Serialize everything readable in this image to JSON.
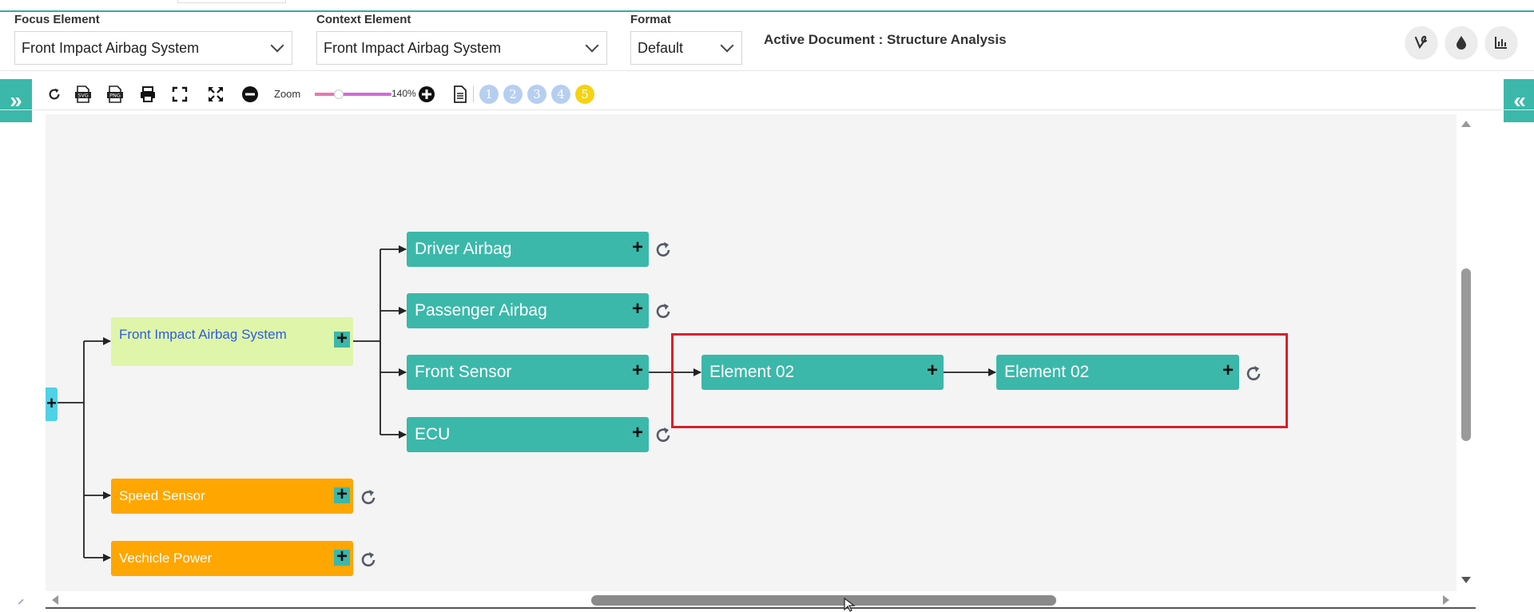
{
  "filters": {
    "focus": {
      "label": "Focus Element",
      "value": "Front Impact Airbag System"
    },
    "context": {
      "label": "Context Element",
      "value": "Front Impact Airbag System"
    },
    "format": {
      "label": "Format",
      "value": "Default"
    },
    "active_document": "Active Document : Structure Analysis"
  },
  "header_buttons": [
    "vine-icon",
    "drop-icon",
    "bar-chart-icon"
  ],
  "toolbar": {
    "icons": [
      "refresh-icon",
      "svg-export-icon",
      "png-export-icon",
      "print-icon",
      "fit-screen-icon",
      "expand-icon",
      "zoom-out-icon"
    ],
    "zoom_label": "Zoom",
    "zoom_value": "140%",
    "zoom_fraction": 0.27,
    "levels": [
      "1",
      "2",
      "3",
      "4",
      "5"
    ],
    "active_level": "5"
  },
  "tree": {
    "root": "Front Impact Airbag System",
    "children": [
      "Driver Airbag",
      "Passenger Airbag",
      "Front Sensor",
      "ECU"
    ],
    "front_sensor_chain": [
      "Element 02",
      "Element 02"
    ],
    "siblings": [
      "Speed Sensor",
      "Vechicle Power"
    ]
  },
  "colors": {
    "accent": "#3bb8aa",
    "root_node": "#dff5a9",
    "sibling_node": "#ffa600",
    "highlight": "#d9202a",
    "active_level": "#f5d312"
  }
}
